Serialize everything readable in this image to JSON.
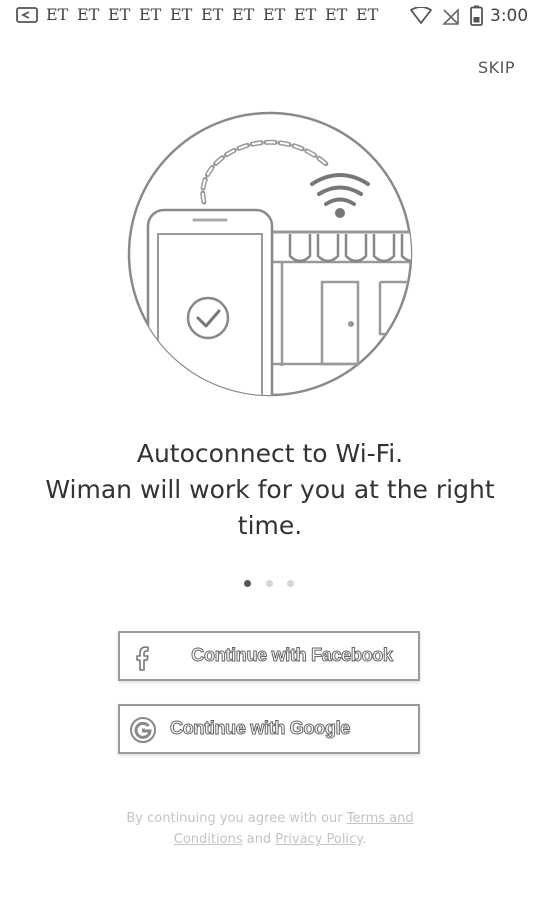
{
  "status_bar": {
    "carriers": [
      "ET",
      "ET",
      "ET",
      "ET",
      "ET",
      "ET",
      "ET",
      "ET",
      "ET",
      "ET",
      "ET"
    ],
    "time": "3:00"
  },
  "header": {
    "skip_label": "SKIP"
  },
  "illustration": {
    "icons": [
      "phone-icon",
      "check-icon",
      "wifi-signal-icon",
      "shop-building-icon",
      "awning-icon"
    ]
  },
  "message": {
    "line1": "Autoconnect to Wi-Fi.",
    "line2": "Wiman will work for you at the right",
    "line3": "time."
  },
  "pager": {
    "count": 3,
    "active": 1
  },
  "buttons": {
    "facebook": {
      "label": "Continue with Facebook",
      "icon": "facebook-icon"
    },
    "google": {
      "label": "Continue with Google",
      "icon": "google-icon"
    }
  },
  "legal": {
    "prefix": "By continuing you agree with our ",
    "terms_link": "Terms and Conditions",
    "middle": " and ",
    "privacy_link": "Privacy Policy",
    "suffix": "."
  },
  "colors": {
    "text": "#333333",
    "muted": "#c4c4c4",
    "border": "#9a9a9a"
  }
}
